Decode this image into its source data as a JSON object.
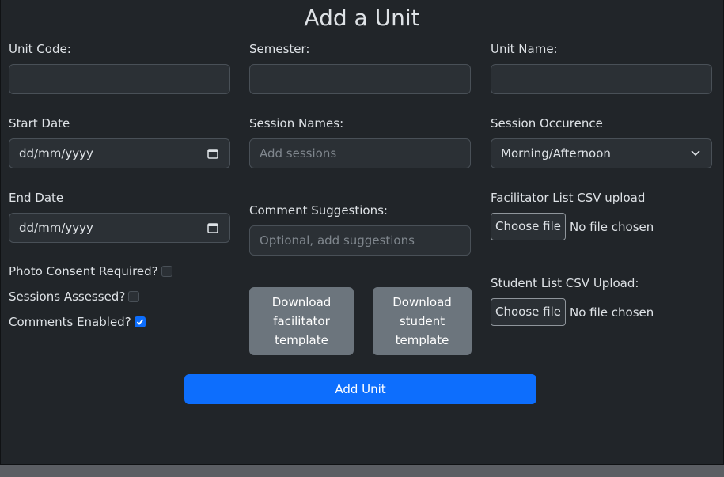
{
  "form": {
    "title": "Add a Unit",
    "unit_code": {
      "label": "Unit Code:",
      "value": ""
    },
    "semester": {
      "label": "Semester:",
      "value": ""
    },
    "unit_name": {
      "label": "Unit Name:",
      "value": ""
    },
    "start_date": {
      "label": "Start Date",
      "display": "dd/mm/yyyy"
    },
    "session_names": {
      "label": "Session Names:",
      "placeholder": "Add sessions"
    },
    "session_occurence": {
      "label": "Session Occurence",
      "selected": "Morning/Afternoon"
    },
    "end_date": {
      "label": "End Date",
      "display": "dd/mm/yyyy"
    },
    "comment_suggestions": {
      "label": "Comment Suggestions:",
      "placeholder": "Optional, add suggestions"
    },
    "facilitator_upload": {
      "label": "Facilitator List CSV upload",
      "button": "Choose file",
      "status": "No file chosen"
    },
    "student_upload": {
      "label": "Student List CSV Upload:",
      "button": "Choose file",
      "status": "No file chosen"
    },
    "checkboxes": [
      {
        "label": "Photo Consent Required?",
        "checked": false
      },
      {
        "label": "Sessions Assessed?",
        "checked": false
      },
      {
        "label": "Comments Enabled?",
        "checked": true
      }
    ],
    "download_facilitator": [
      "Download",
      "facilitator",
      "template"
    ],
    "download_student": [
      "Download",
      "student",
      "template"
    ],
    "submit_label": "Add Unit"
  },
  "colors": {
    "background": "#212529",
    "input_bg": "#2b3035",
    "primary": "#0d6efd",
    "secondary": "#6c757d"
  }
}
